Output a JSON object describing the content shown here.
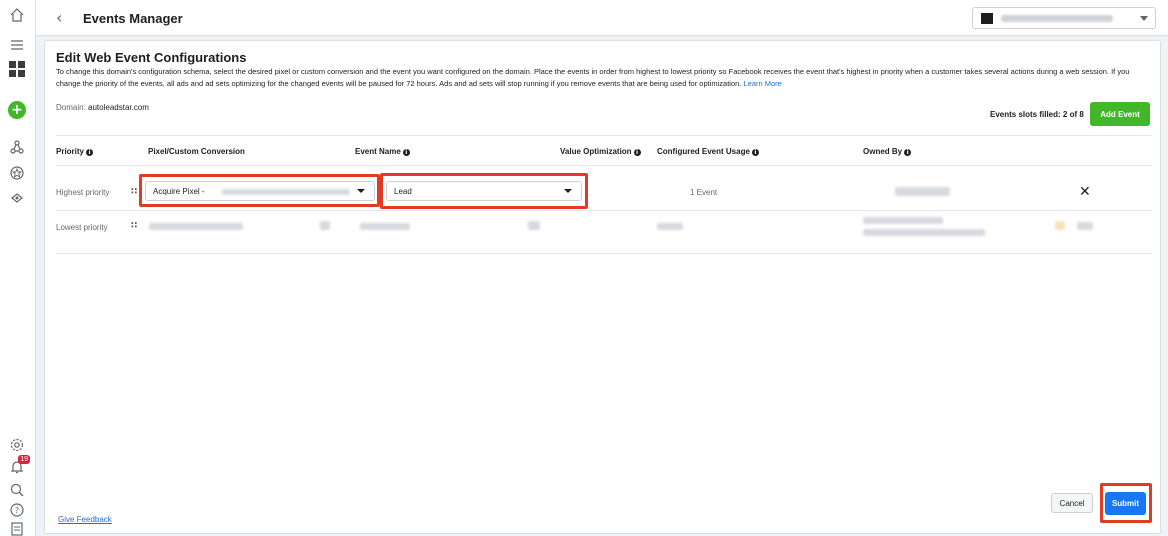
{
  "header": {
    "title": "Events Manager",
    "back_icon": "chevron-left-icon",
    "account_selector": {
      "icon": "business-square-icon",
      "caret": "caret-down-icon"
    }
  },
  "rail": {
    "icons": [
      "home-icon",
      "menu-icon",
      "business-logo-icon",
      "create-plus-icon",
      "events-manager-icon",
      "ads-manager-icon",
      "audience-icon",
      "settings-icon",
      "notifications-icon",
      "search-icon",
      "help-icon",
      "reports-icon"
    ],
    "notification_badge": "19"
  },
  "page": {
    "title": "Edit Web Event Configurations",
    "description": "To change this domain's configuration schema, select the desired pixel or custom conversion and the event you want configured on the domain. Place the events in order from highest to lowest priority so Facebook receives the event that's highest in priority when a customer takes several actions during a web session. If you change the priority of the events, all ads and ad sets optimizing for the changed events will be paused for 72 hours. Ads and ad sets will stop running if you remove events that are being used for optimization.",
    "learn_more": "Learn More",
    "domain_label": "Domain:",
    "domain_value": "autoleadstar.com",
    "slots_text": "Events slots filled: 2 of 8",
    "add_event_label": "Add Event"
  },
  "table": {
    "columns": {
      "priority": "Priority",
      "pixel": "Pixel/Custom Conversion",
      "event_name": "Event Name",
      "value_opt": "Value Optimization",
      "usage": "Configured Event Usage",
      "owner": "Owned By"
    },
    "rows": [
      {
        "priority": "Highest priority",
        "pixel_prefix": "Acquire Pixel - ",
        "event_name": "Lead",
        "usage": "1 Event"
      },
      {
        "priority": "Lowest priority"
      }
    ]
  },
  "footer": {
    "feedback": "Give Feedback",
    "cancel": "Cancel",
    "submit": "Submit"
  },
  "colors": {
    "primary": "#1877f2",
    "add_event_green": "#42b72a",
    "highlight_red": "#e03b24",
    "link": "#216fdb"
  }
}
